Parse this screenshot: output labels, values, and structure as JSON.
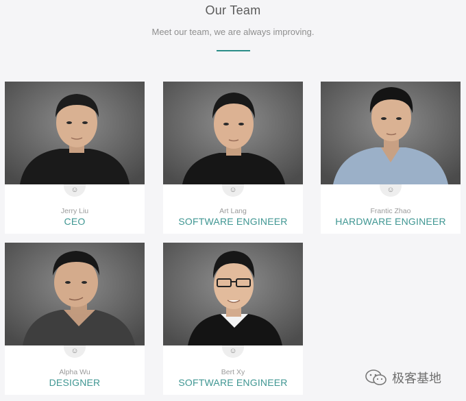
{
  "header": {
    "title": "Our Team",
    "subtitle": "Meet our team, we are always improving."
  },
  "colors": {
    "accent": "#2a8d88",
    "role_text": "#3f9692",
    "background": "#f5f5f7"
  },
  "team": [
    {
      "name": "Jerry Liu",
      "role": "CEO",
      "icon": "smiley-icon",
      "icon_glyph": "☺"
    },
    {
      "name": "Art Lang",
      "role": "SOFTWARE ENGINEER",
      "icon": "smiley-icon",
      "icon_glyph": "☺"
    },
    {
      "name": "Frantic Zhao",
      "role": "HARDWARE ENGINEER",
      "icon": "smiley-icon",
      "icon_glyph": "☺"
    },
    {
      "name": "Alpha Wu",
      "role": "DESIGNER",
      "icon": "smiley-icon",
      "icon_glyph": "☺"
    },
    {
      "name": "Bert Xy",
      "role": "SOFTWARE ENGINEER",
      "icon": "smiley-icon",
      "icon_glyph": "☺"
    }
  ],
  "watermark": {
    "text": "极客基地",
    "icon": "wechat-icon"
  }
}
